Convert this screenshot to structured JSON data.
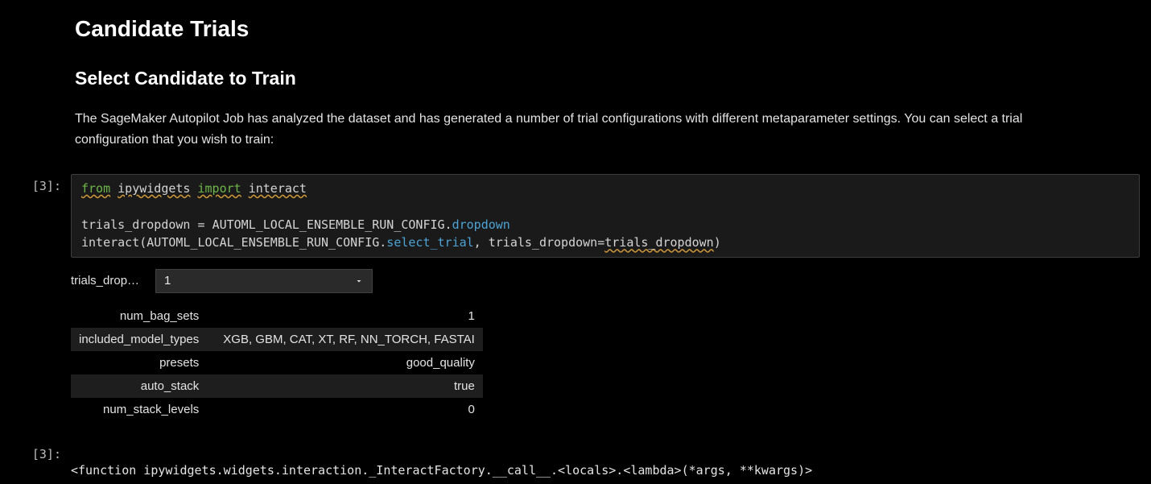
{
  "title": "Candidate Trials",
  "subtitle": "Select Candidate to Train",
  "description": "The SageMaker Autopilot Job has analyzed the dataset and has generated a number of trial configurations with different metaparameter settings. You can select a trial configuration that you wish to train:",
  "prompt_in": "[3]:",
  "code": {
    "kw_from": "from",
    "module": "ipywidgets",
    "kw_import": "import",
    "name_interact": "interact",
    "line_blank": "",
    "var_trials": "trials_dropdown",
    "eq": " = ",
    "config_const": "AUTOML_LOCAL_ENSEMBLE_RUN_CONFIG",
    "dot": ".",
    "attr_dropdown": "dropdown",
    "call_interact": "interact",
    "open": "(",
    "attr_select_trial": "select_trial",
    "comma_sp": ", ",
    "kw_arg": "trials_dropdown",
    "eq2": "=",
    "arg_val": "trials_dropdown",
    "close": ")"
  },
  "widget": {
    "label": "trials_drop…",
    "selected": "1"
  },
  "params": [
    {
      "key": "num_bag_sets",
      "val": "1"
    },
    {
      "key": "included_model_types",
      "val": "XGB, GBM, CAT, XT, RF, NN_TORCH, FASTAI"
    },
    {
      "key": "presets",
      "val": "good_quality"
    },
    {
      "key": "auto_stack",
      "val": "true"
    },
    {
      "key": "num_stack_levels",
      "val": "0"
    }
  ],
  "prompt_out": "[3]:",
  "output_text": "<function ipywidgets.widgets.interaction._InteractFactory.__call__.<locals>.<lambda>(*args, **kwargs)>"
}
